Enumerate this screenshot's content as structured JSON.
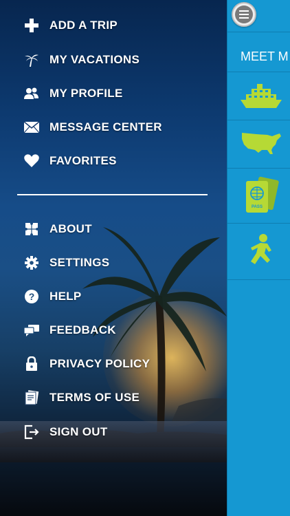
{
  "menu": {
    "primary": [
      {
        "label": "ADD A TRIP",
        "icon": "plus-icon"
      },
      {
        "label": "MY VACATIONS",
        "icon": "palm-tree-icon"
      },
      {
        "label": "MY PROFILE",
        "icon": "people-icon"
      },
      {
        "label": "MESSAGE CENTER",
        "icon": "envelope-icon"
      },
      {
        "label": "FAVORITES",
        "icon": "heart-icon"
      }
    ],
    "secondary": [
      {
        "label": "ABOUT",
        "icon": "puzzle-icon"
      },
      {
        "label": "SETTINGS",
        "icon": "gear-icon"
      },
      {
        "label": "HELP",
        "icon": "question-icon"
      },
      {
        "label": "FEEDBACK",
        "icon": "chat-bubbles-icon"
      },
      {
        "label": "PRIVACY POLICY",
        "icon": "lock-icon"
      },
      {
        "label": "TERMS OF USE",
        "icon": "document-icon"
      },
      {
        "label": "SIGN OUT",
        "icon": "sign-out-icon"
      }
    ]
  },
  "panel": {
    "title": "MEET M",
    "tiles": [
      "cruise-ship-icon",
      "usa-map-icon",
      "passport-icon",
      "running-figure-icon"
    ]
  },
  "colors": {
    "panel": "#1598d2",
    "tile_green": "#b6d935"
  }
}
